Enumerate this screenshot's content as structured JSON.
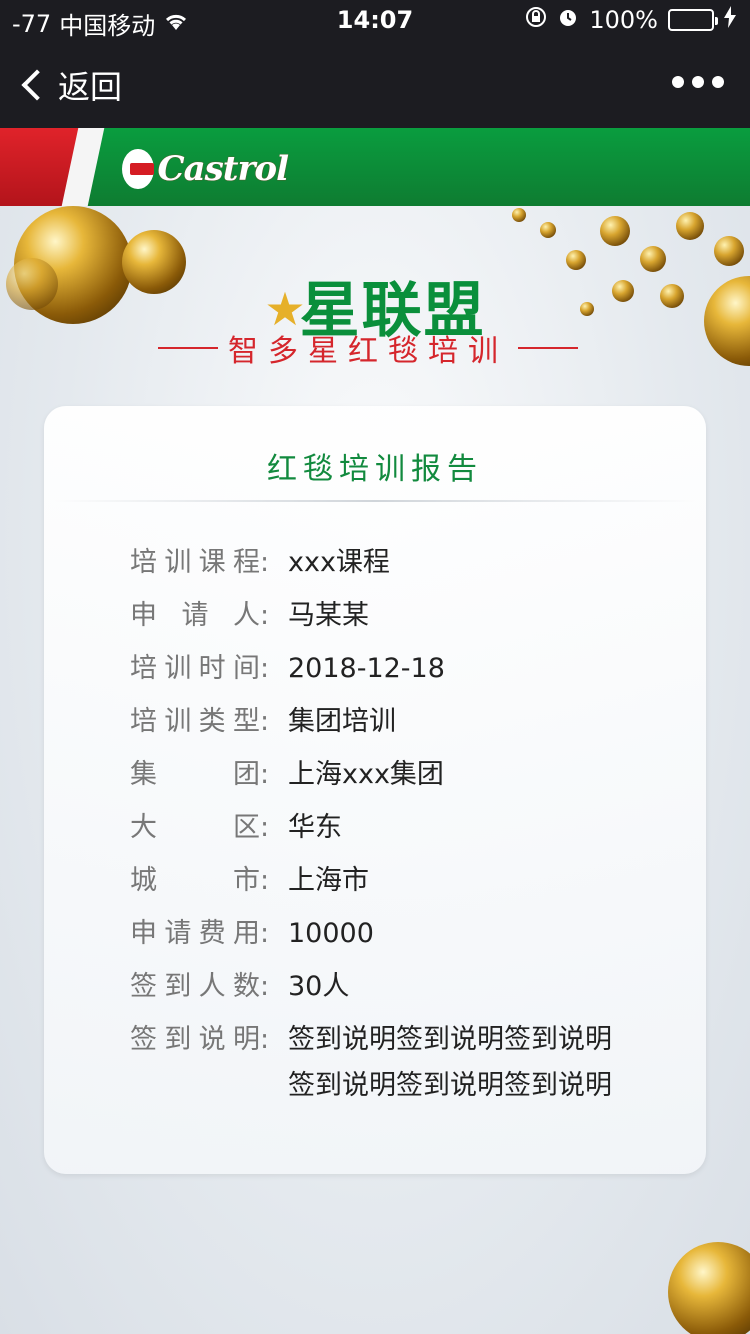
{
  "status_bar": {
    "signal": "-77",
    "carrier": "中国移动",
    "time": "14:07",
    "battery": "100%"
  },
  "nav": {
    "back_label": "返回"
  },
  "brand": {
    "logo_text": "Castrol"
  },
  "header": {
    "title": "星联盟",
    "subtitle": "智多星红毯培训"
  },
  "report": {
    "title": "红毯培训报告",
    "fields": [
      {
        "label": "培训课程",
        "value": "xxx课程"
      },
      {
        "label": "申请人",
        "value": "马某某"
      },
      {
        "label": "培训时间",
        "value": "2018-12-18"
      },
      {
        "label": "培训类型",
        "value": "集团培训"
      },
      {
        "label": "集团",
        "value": "上海xxx集团"
      },
      {
        "label": "大区",
        "value": "华东"
      },
      {
        "label": "城市",
        "value": "上海市"
      },
      {
        "label": "申请费用",
        "value": "10000"
      },
      {
        "label": "签到人数",
        "value": "30人"
      },
      {
        "label": "签到说明",
        "value": "签到说明签到说明签到说明签到说明签到说明签到说明"
      }
    ]
  },
  "colors": {
    "brand_green": "#0a9d3f",
    "brand_red": "#d5262c",
    "title_green": "#128a3e"
  }
}
